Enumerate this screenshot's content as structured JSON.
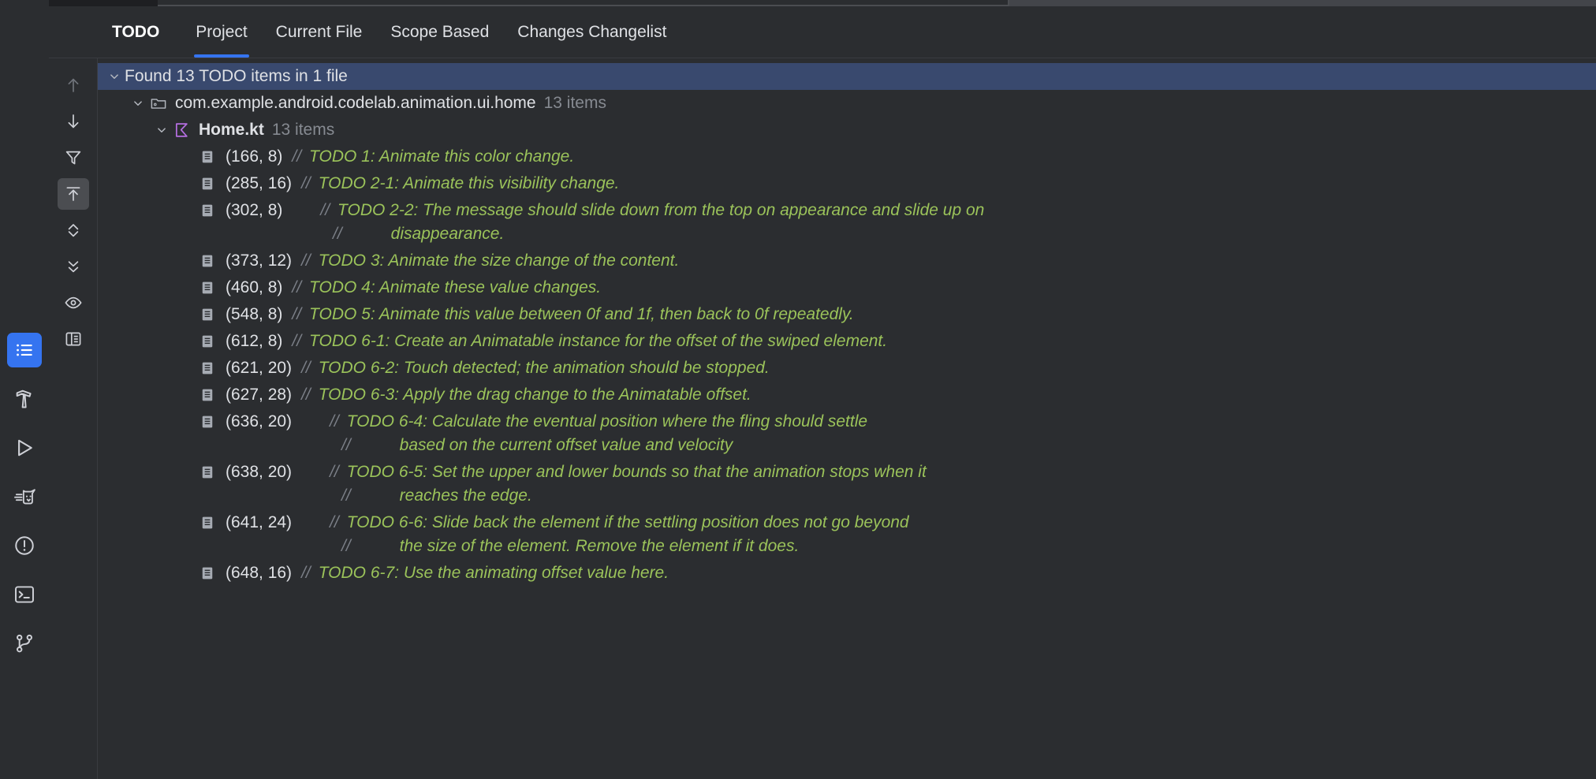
{
  "window": {
    "background": "#2b2d30",
    "accent": "#3574f0",
    "selection": "#39496e",
    "todo_text_color": "#9bc35a",
    "comment_marker_color": "#7b7f87"
  },
  "tool_sidebar": {
    "items": [
      {
        "name": "todo-tool-window",
        "icon": "todo-list-icon",
        "label": "TODO",
        "active": true
      },
      {
        "name": "build-tool-window",
        "icon": "hammer-icon",
        "label": "Build",
        "active": false
      },
      {
        "name": "run-tool-window",
        "icon": "play-icon",
        "label": "Run",
        "active": false
      },
      {
        "name": "logcat-tool-window",
        "icon": "cat-icon",
        "label": "Logcat",
        "active": false
      },
      {
        "name": "problems-tool-window",
        "icon": "warning-circle-icon",
        "label": "Problems",
        "active": false
      },
      {
        "name": "terminal-tool-window",
        "icon": "terminal-icon",
        "label": "Terminal",
        "active": false
      },
      {
        "name": "version-control-tool-window",
        "icon": "git-branch-icon",
        "label": "Version Control",
        "active": false
      }
    ]
  },
  "tabs": {
    "title": "TODO",
    "items": [
      {
        "label": "Project",
        "selected": true
      },
      {
        "label": "Current File",
        "selected": false
      },
      {
        "label": "Scope Based",
        "selected": false
      },
      {
        "label": "Changes Changelist",
        "selected": false
      }
    ]
  },
  "toolbar": {
    "buttons": [
      {
        "name": "previous-occurrence-button",
        "icon": "arrow-up-icon",
        "enabled": false,
        "toggled": false
      },
      {
        "name": "next-occurrence-button",
        "icon": "arrow-down-icon",
        "enabled": true,
        "toggled": false
      },
      {
        "name": "filter-button",
        "icon": "funnel-icon",
        "enabled": true,
        "toggled": false
      },
      {
        "name": "autoscroll-to-source-button",
        "icon": "arrow-to-top-icon",
        "enabled": true,
        "toggled": true
      },
      {
        "name": "expand-collapse-button",
        "icon": "chevrons-up-down-icon",
        "enabled": true,
        "toggled": false
      },
      {
        "name": "collapse-all-button",
        "icon": "collapse-all-icon",
        "enabled": true,
        "toggled": false
      },
      {
        "name": "preview-source-button",
        "icon": "eye-icon",
        "enabled": true,
        "toggled": false
      },
      {
        "name": "layout-settings-button",
        "icon": "panel-layout-icon",
        "enabled": true,
        "toggled": false
      }
    ]
  },
  "tree": {
    "root": {
      "label": "Found 13 TODO items in 1 file",
      "selected": true,
      "expanded": true
    },
    "package": {
      "label": "com.example.android.codelab.animation.ui.home",
      "count": "13 items",
      "icon": "package-folder-icon",
      "expanded": true
    },
    "file": {
      "label": "Home.kt",
      "count": "13 items",
      "icon": "kotlin-file-icon",
      "expanded": true
    },
    "items": [
      {
        "position": "(166, 8)",
        "gap": 0,
        "marker": "//",
        "text": "TODO 1: Animate this color change.",
        "continuations": []
      },
      {
        "position": "(285, 16)",
        "gap": 0,
        "marker": "//",
        "text": "TODO 2-1: Animate this visibility change.",
        "continuations": []
      },
      {
        "position": "(302, 8)",
        "gap": 1,
        "marker": "//",
        "text": "TODO 2-2: The message should slide down from the top on appearance and slide up on",
        "continuations": [
          {
            "marker": "//",
            "text": "disappearance."
          }
        ]
      },
      {
        "position": "(373, 12)",
        "gap": 0,
        "marker": "//",
        "text": "TODO 3: Animate the size change of the content.",
        "continuations": []
      },
      {
        "position": "(460, 8)",
        "gap": 0,
        "marker": "//",
        "text": "TODO 4: Animate these value changes.",
        "continuations": []
      },
      {
        "position": "(548, 8)",
        "gap": 0,
        "marker": "//",
        "text": "TODO 5: Animate this value between 0f and 1f, then back to 0f repeatedly.",
        "continuations": []
      },
      {
        "position": "(612, 8)",
        "gap": 0,
        "marker": "//",
        "text": "TODO 6-1: Create an Animatable instance for the offset of the swiped element.",
        "continuations": []
      },
      {
        "position": "(621, 20)",
        "gap": 0,
        "marker": "//",
        "text": "TODO 6-2: Touch detected; the animation should be stopped.",
        "continuations": []
      },
      {
        "position": "(627, 28)",
        "gap": 0,
        "marker": "//",
        "text": "TODO 6-3: Apply the drag change to the Animatable offset.",
        "continuations": []
      },
      {
        "position": "(636, 20)",
        "gap": 1,
        "marker": "//",
        "text": "TODO 6-4: Calculate the eventual position where the fling should settle",
        "continuations": [
          {
            "marker": "//",
            "text": "based on the current offset value and velocity"
          }
        ]
      },
      {
        "position": "(638, 20)",
        "gap": 1,
        "marker": "//",
        "text": "TODO 6-5: Set the upper and lower bounds so that the animation stops when it",
        "continuations": [
          {
            "marker": "//",
            "text": "reaches the edge."
          }
        ]
      },
      {
        "position": "(641, 24)",
        "gap": 1,
        "marker": "//",
        "text": "TODO 6-6: Slide back the element if the settling position does not go beyond",
        "continuations": [
          {
            "marker": "//",
            "text": "the size of the element. Remove the element if it does."
          }
        ]
      },
      {
        "position": "(648, 16)",
        "gap": 0,
        "marker": "//",
        "text": "TODO 6-7: Use the animating offset value here.",
        "continuations": []
      }
    ]
  }
}
